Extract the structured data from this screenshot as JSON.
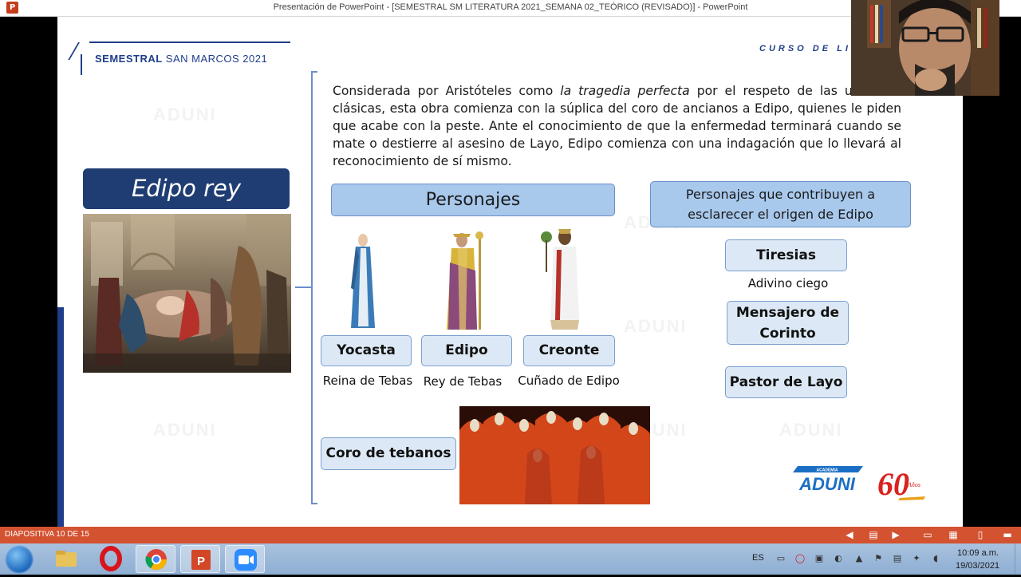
{
  "window": {
    "app_icon": "P",
    "title": "Presentación de PowerPoint - [SEMESTRAL SM LITERATURA 2021_SEMANA 02_TEÓRICO (REVISADO)] - PowerPoint"
  },
  "slide": {
    "brand_bold": "SEMESTRAL",
    "brand_rest": " SAN MARCOS 2021",
    "course": "CURSO DE LIT",
    "watermark": "ADUNI",
    "title": "Edipo rey",
    "paragraph": {
      "part1": "Considerada por Aristóteles como ",
      "italic": "la tragedia perfecta",
      "part2": " por el respeto de las unidades clásicas, esta obra comienza con la súplica del coro de ancianos a Edipo, quienes le piden que acabe con la peste. Ante el conocimiento de que la enfermedad terminará cuando se mate o destierre al asesino de Layo, Edipo comienza con una indagación que lo llevará al reconocimiento de sí mismo."
    },
    "personajes_header": "Personajes",
    "contributors_header": "Personajes que contribuyen a esclarecer el origen de Edipo",
    "characters": [
      {
        "name": "Yocasta",
        "role": "Reina de Tebas"
      },
      {
        "name": "Edipo",
        "role": "Rey de Tebas"
      },
      {
        "name": "Creonte",
        "role": "Cuñado de Edipo"
      }
    ],
    "contributors": [
      {
        "name": "Tiresias",
        "note": "Adivino ciego"
      },
      {
        "name": "Mensajero de Corinto"
      },
      {
        "name": "Pastor de Layo"
      }
    ],
    "chorus": "Coro de tebanos",
    "logo": {
      "academia": "ACADEMIA",
      "aduni": "ADUNI",
      "sixty": "60",
      "anos": "Años"
    }
  },
  "statusbar": {
    "slide_info": "DIAPOSITIVA 10 DE 15"
  },
  "taskbar": {
    "apps": [
      "file-explorer",
      "opera",
      "chrome",
      "powerpoint",
      "zoom"
    ],
    "lang": "ES",
    "time": "10:09 a.m.",
    "date": "19/03/2021"
  },
  "colors": {
    "accent": "#1f3d8a",
    "status": "#d35230",
    "box": "#a8c8ec"
  }
}
